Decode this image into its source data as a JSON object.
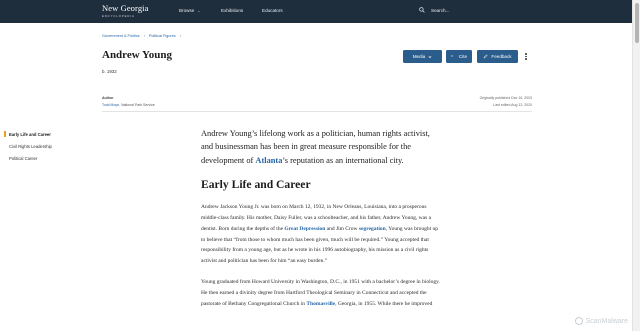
{
  "brand": {
    "title": "New Georgia",
    "subtitle": "ENCYCLOPEDIA"
  },
  "nav": {
    "browse": "Browse",
    "exhibitions": "Exhibitions",
    "educators": "Educators",
    "search": "Search..."
  },
  "breadcrumb": [
    "Government & Politics",
    "Political Figures"
  ],
  "page": {
    "title": "Andrew Young",
    "born": "b. 1932"
  },
  "actions": {
    "media": "Media",
    "cite": "Cite",
    "feedback": "Feedback"
  },
  "author": {
    "label": "Author",
    "name": "Todd Moye",
    "affiliation": ", National Park Service",
    "published": "Originally published Dec 16, 2003",
    "edited": "Last edited Aug 12, 2020"
  },
  "toc": [
    "Early Life and Career",
    "Civil Rights Leadership",
    "Political Career"
  ],
  "article": {
    "lead_1": "Andrew Young’s lifelong work as a politician, human rights activist, and businessman has been in great measure responsible for the development of ",
    "lead_link": "Atlanta",
    "lead_2": "’s reputation as an international city.",
    "section_heading": "Early Life and Career",
    "p1_a": "Andrew Jackson Young Jr. was born on March 12, 1932, in New Orleans, Louisiana, into a prosperous middle-class family. His mother, Daisy Fuller, was a schoolteacher, and his father, Andrew Young, was a dentist. Born during the depths of the ",
    "p1_link1": "Great Depression",
    "p1_b": " and Jim Crow ",
    "p1_link2": "segregation",
    "p1_c": ", Young was brought up to believe that “from those to whom much has been given, much will be required.” Young accepted that responsibility from a young age, but as he wrote in his 1996 autobiography, his mission as a civil rights activist and politician has been for him “an easy burden.”",
    "p2_a": "Young graduated from Howard University in Washington, D.C., in 1951 with a bachelor’s degree in biology. He then earned a divinity degree from Hartford Theological Seminary in Connecticut and accepted the pastorate of Bethany Congregational Church in ",
    "p2_link": "Thomasville",
    "p2_b": ", Georgia, in 1955. While there he improved"
  },
  "watermark": "ScanMalware"
}
